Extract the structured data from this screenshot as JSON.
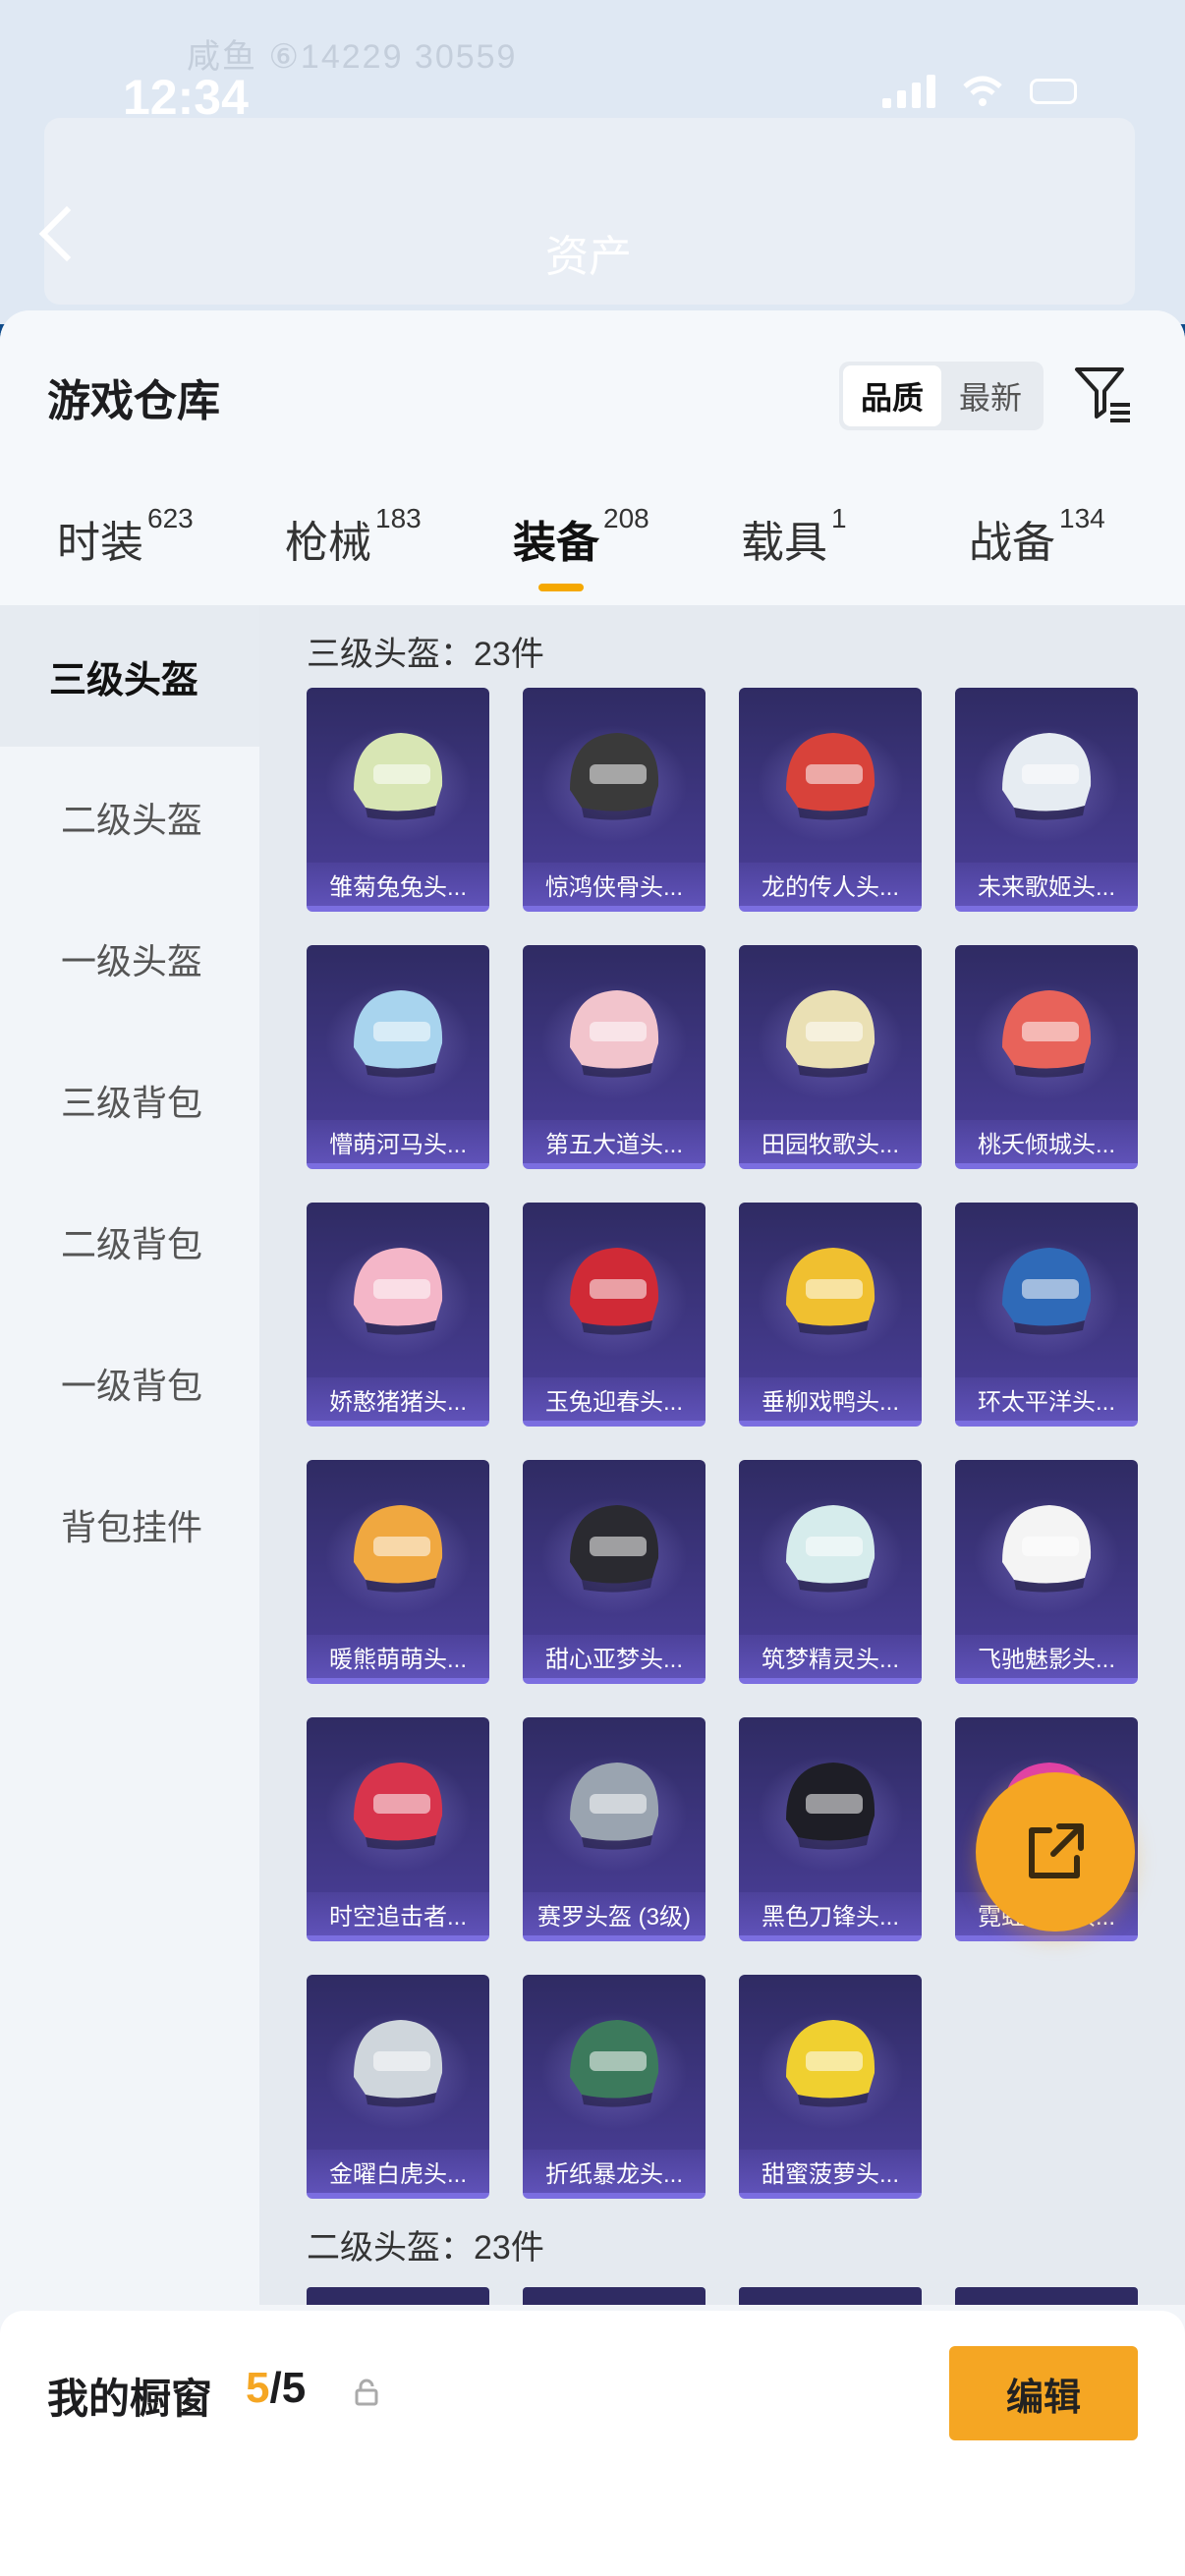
{
  "status_bar": {
    "time": "12:34"
  },
  "background_header": {
    "faint_text": "咸鱼 ⑥14229    30559",
    "title": "资产"
  },
  "warehouse": {
    "title": "游戏仓库",
    "sort_options": [
      "品质",
      "最新"
    ],
    "active_sort": "品质"
  },
  "tabs": [
    {
      "label": "时装",
      "count": "623"
    },
    {
      "label": "枪械",
      "count": "183"
    },
    {
      "label": "装备",
      "count": "208"
    },
    {
      "label": "载具",
      "count": "1"
    },
    {
      "label": "战备",
      "count": "134"
    }
  ],
  "active_tab": "装备",
  "sidebar": {
    "items": [
      "三级头盔",
      "二级头盔",
      "一级头盔",
      "三级背包",
      "二级背包",
      "一级背包",
      "背包挂件"
    ],
    "active": "三级头盔"
  },
  "sections": [
    {
      "title": "三级头盔：23件",
      "items": [
        {
          "name": "雏菊兔兔头...",
          "color": "#d8e6b4"
        },
        {
          "name": "惊鸿侠骨头...",
          "color": "#3a3a3a"
        },
        {
          "name": "龙的传人头...",
          "color": "#d8423a"
        },
        {
          "name": "未来歌姬头...",
          "color": "#e6ecf2"
        },
        {
          "name": "懵萌河马头...",
          "color": "#a8d4ee"
        },
        {
          "name": "第五大道头...",
          "color": "#f2c4cc"
        },
        {
          "name": "田园牧歌头...",
          "color": "#eae0b4"
        },
        {
          "name": "桃夭倾城头...",
          "color": "#e8635a"
        },
        {
          "name": "娇憨猪猪头...",
          "color": "#f4b6c8"
        },
        {
          "name": "玉兔迎春头...",
          "color": "#d02a36"
        },
        {
          "name": "垂柳戏鸭头...",
          "color": "#f0c030"
        },
        {
          "name": "环太平洋头...",
          "color": "#2f6ab8"
        },
        {
          "name": "暖熊萌萌头...",
          "color": "#f0a840"
        },
        {
          "name": "甜心亚梦头...",
          "color": "#2a2a30"
        },
        {
          "name": "筑梦精灵头...",
          "color": "#d6ecec"
        },
        {
          "name": "飞驰魅影头...",
          "color": "#f4f4f4"
        },
        {
          "name": "时空追击者...",
          "color": "#d8344c"
        },
        {
          "name": "赛罗头盔 (3级)",
          "color": "#9aa4b0"
        },
        {
          "name": "黑色刀锋头...",
          "color": "#1e1e26"
        },
        {
          "name": "霓虹街区头...",
          "color": "#e040a8"
        },
        {
          "name": "金曜白虎头...",
          "color": "#cfd6dc"
        },
        {
          "name": "折纸暴龙头...",
          "color": "#3c7a5c"
        },
        {
          "name": "甜蜜菠萝头...",
          "color": "#f0d030"
        }
      ]
    },
    {
      "title": "二级头盔：23件",
      "items": []
    }
  ],
  "showcase": {
    "label": "我的橱窗",
    "current": "5",
    "total": "/5",
    "edit_label": "编辑"
  },
  "colors": {
    "accent": "#f5a623",
    "card_bg": "#2f2b63"
  }
}
